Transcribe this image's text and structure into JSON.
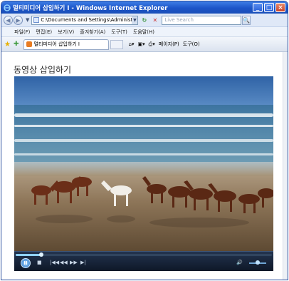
{
  "window": {
    "title": "멀티미디어 삽입하기 I - Windows Internet Explorer",
    "minimize": "_",
    "maximize": "□",
    "close": "×"
  },
  "address_bar": {
    "back": "◀",
    "forward": "▶",
    "url": "C:\\Documents and Settings\\Administr",
    "refresh": "↻",
    "stop": "✕",
    "search_placeholder": "Live Search",
    "search_button": "🔍"
  },
  "menu": [
    "파일(F)",
    "편집(E)",
    "보기(V)",
    "즐겨찾기(A)",
    "도구(T)",
    "도움말(H)"
  ],
  "tabs": {
    "active_tab": "멀티미디어 삽입하기 I",
    "commands": [
      "페이지(P)",
      "도구(O)"
    ]
  },
  "page": {
    "heading": "동영상 삽입하기"
  },
  "media_player": {
    "progress": 0.1,
    "volume": 0.5,
    "play_pause": "II",
    "buttons": [
      "■",
      "|◀◀",
      "◀◀",
      "▶▶",
      "▶|",
      "🔊"
    ]
  },
  "icons": {
    "ie_logo": "ie-icon",
    "favorites": "star-icon",
    "add_favorites": "add-favorite-icon",
    "home": "home-icon",
    "feeds": "feed-icon",
    "print": "print-icon"
  },
  "colors": {
    "titlebar": "#1c55c8",
    "video_sky": "#2f63a6",
    "player_bar": "#0e1727"
  }
}
